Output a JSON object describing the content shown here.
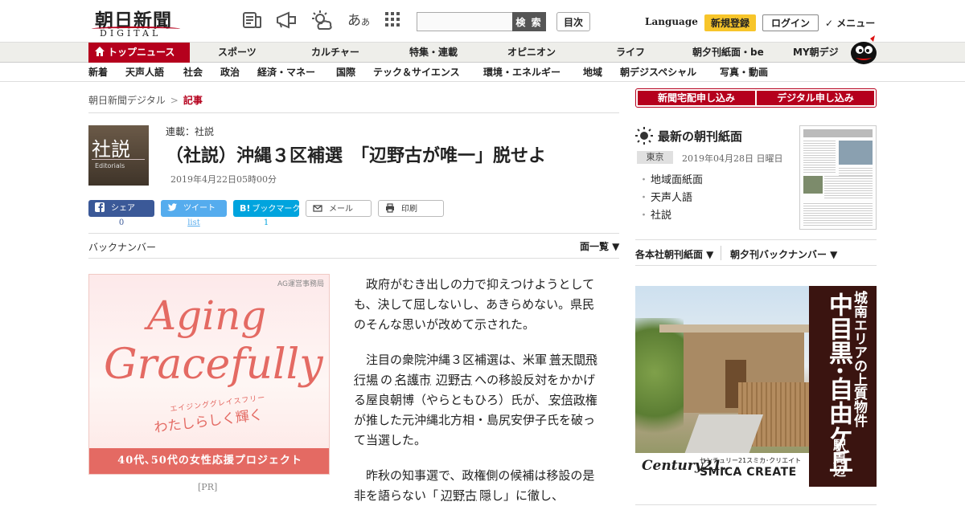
{
  "header": {
    "logo_jp": "朝日新聞",
    "logo_en": "DIGITAL",
    "font_toggle_large": "あ",
    "font_toggle_small": "あ",
    "search_placeholder": "",
    "search_button": "検 索",
    "toc_button": "目次",
    "language_label": "Language",
    "register_button": "新規登録",
    "login_button": "ログイン",
    "menu_button": "✓ メニュー",
    "icons": [
      "newspaper-icon",
      "megaphone-icon",
      "weather-icon",
      "font-size-icon",
      "grid-icon"
    ]
  },
  "nav_primary": {
    "items": [
      "トップニュース",
      "スポーツ",
      "カルチャー",
      "特集・連載",
      "オピニオン",
      "ライフ",
      "朝夕刊紙面・be",
      "MY朝デジ"
    ]
  },
  "nav_secondary": {
    "items": [
      "新着",
      "天声人語",
      "社会",
      "政治",
      "経済・マネー",
      "国際",
      "テック＆サイエンス",
      "環境・エネルギー",
      "地域",
      "朝デジスペシャル",
      "写真・動画"
    ]
  },
  "breadcrumb": {
    "home": "朝日新聞デジタル",
    "separator": ">",
    "current": "記事"
  },
  "article": {
    "thumb_kanji": "社説",
    "thumb_en": "Editorials",
    "series": "連載：社説",
    "title": "（社説）沖縄３区補選　「辺野古が唯一」脱せよ",
    "date": "2019年4月22日05時00分",
    "body_p1": "政府がむき出しの力で抑えつけようとしても、決して屈しないし、あきらめない。県民のそんな思いが改めて示された。",
    "body_p2_a": "注目の衆院沖縄３区補選は、米軍",
    "body_p2_kw1": "普天間飛行場",
    "body_p2_b": "の",
    "body_p2_kw2": "名護市",
    "body_p2_kw3": "辺野古",
    "body_p2_c": "への移設反対をかかげる屋良朝博（やらともひろ）氏が、",
    "body_p2_kw4": "安倍政権",
    "body_p2_d": "が推した元沖縄北方相・島尻安伊子氏を破って当選した。",
    "body_p3_a": "昨秋の知事選で、政権側の候補は移設の是非を語らない「",
    "body_p3_kw1": "辺野古",
    "body_p3_b": "隠し」に徹し、"
  },
  "share": {
    "facebook_label": "シェア",
    "facebook_count": "0",
    "twitter_label": "ツイート",
    "twitter_count": "list",
    "hatena_label": "ブックマーク",
    "hatena_badge": "B!",
    "hatena_count": "1",
    "mail_label": "メール",
    "print_label": "印刷"
  },
  "backnumber": {
    "label": "バックナンバー",
    "page_list": "面一覧 ▼"
  },
  "ad_left": {
    "sponsor": "AG運営事務局",
    "line1": "Aging",
    "line2": "Gracefully",
    "line3": "エイジンググレイスフリー",
    "line4": "わたしらしく輝く",
    "band": "40代､50代の女性応援プロジェクト",
    "pr": "[PR]"
  },
  "sidebar": {
    "subscribe_paper": "新聞宅配申し込み",
    "subscribe_digital": "デジタル申し込み",
    "latest_title": "最新の朝刊紙面",
    "edition_tag": "東京",
    "edition_date": "2019年04月28日 日曜日",
    "edition_links": [
      "地域面紙面",
      "天声人語",
      "社説"
    ],
    "archive_paper": "各本社朝刊紙面 ▼",
    "archive_backnumber": "朝夕刊バックナンバー ▼"
  },
  "ad_right": {
    "vertical_1": "城南エリアの上質物件",
    "vertical_2": "中目黒･自由ケ丘",
    "vertical_3": "駅周辺",
    "brand_c21": "Century21.",
    "brand_jp": "センチュリー21スミカ･クリエイト",
    "brand_en": "SMICA CREATE"
  },
  "colors": {
    "brand_red": "#b5001d",
    "register_yellow": "#f7c52a",
    "facebook": "#3b5998",
    "twitter": "#55acee",
    "hatena": "#00a4de",
    "ad_pink": "#e46a63"
  }
}
